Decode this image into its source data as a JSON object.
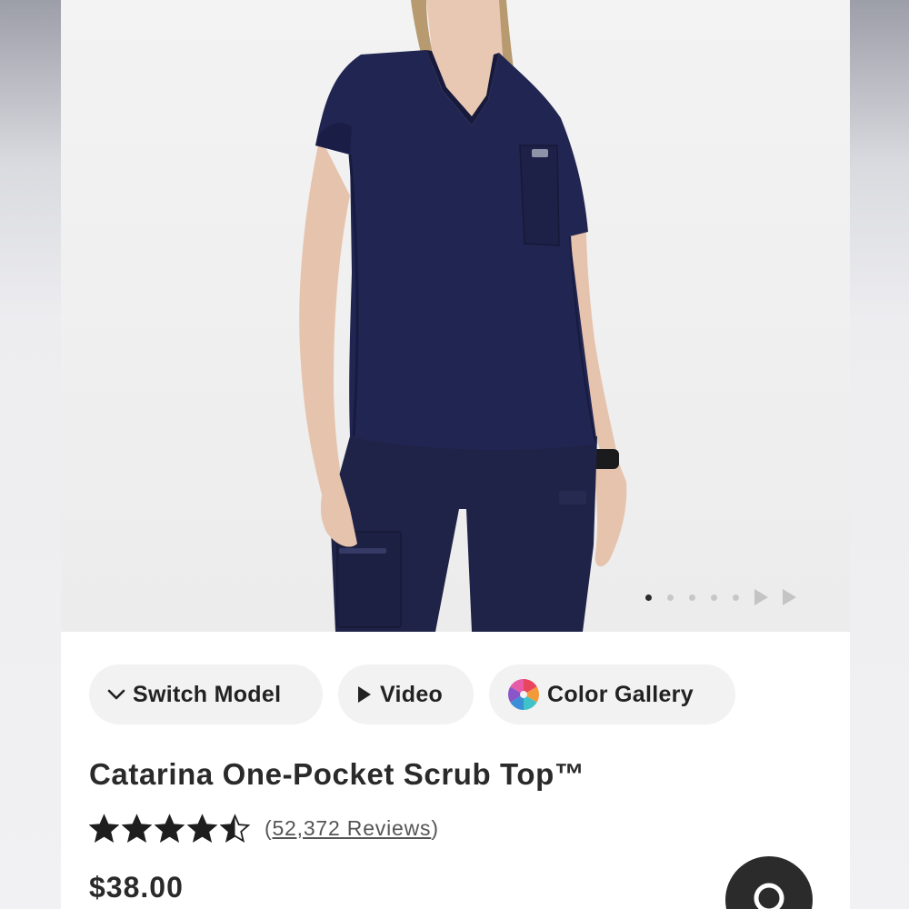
{
  "product": {
    "title": "Catarina One-Pocket Scrub Top™",
    "rating": 4.5,
    "rating_max": 5,
    "reviews_open": "(",
    "reviews_label": "52,372 Reviews",
    "reviews_close": ")",
    "price": "$38.00",
    "color": "#1f2347"
  },
  "carousel": {
    "image_count": 5,
    "active_index": 0
  },
  "actions": {
    "switch_model": "Switch Model",
    "video": "Video",
    "color_gallery": "Color Gallery"
  },
  "icons": {
    "switch_model": "chevron-down-icon",
    "video": "play-icon",
    "color_gallery": "color-wheel-icon",
    "chat": "chat-bubble-icon"
  },
  "colors": {
    "accent_dark": "#2b2b2b",
    "chip_bg": "#f2f2f2",
    "star": "#1e1e1e"
  }
}
